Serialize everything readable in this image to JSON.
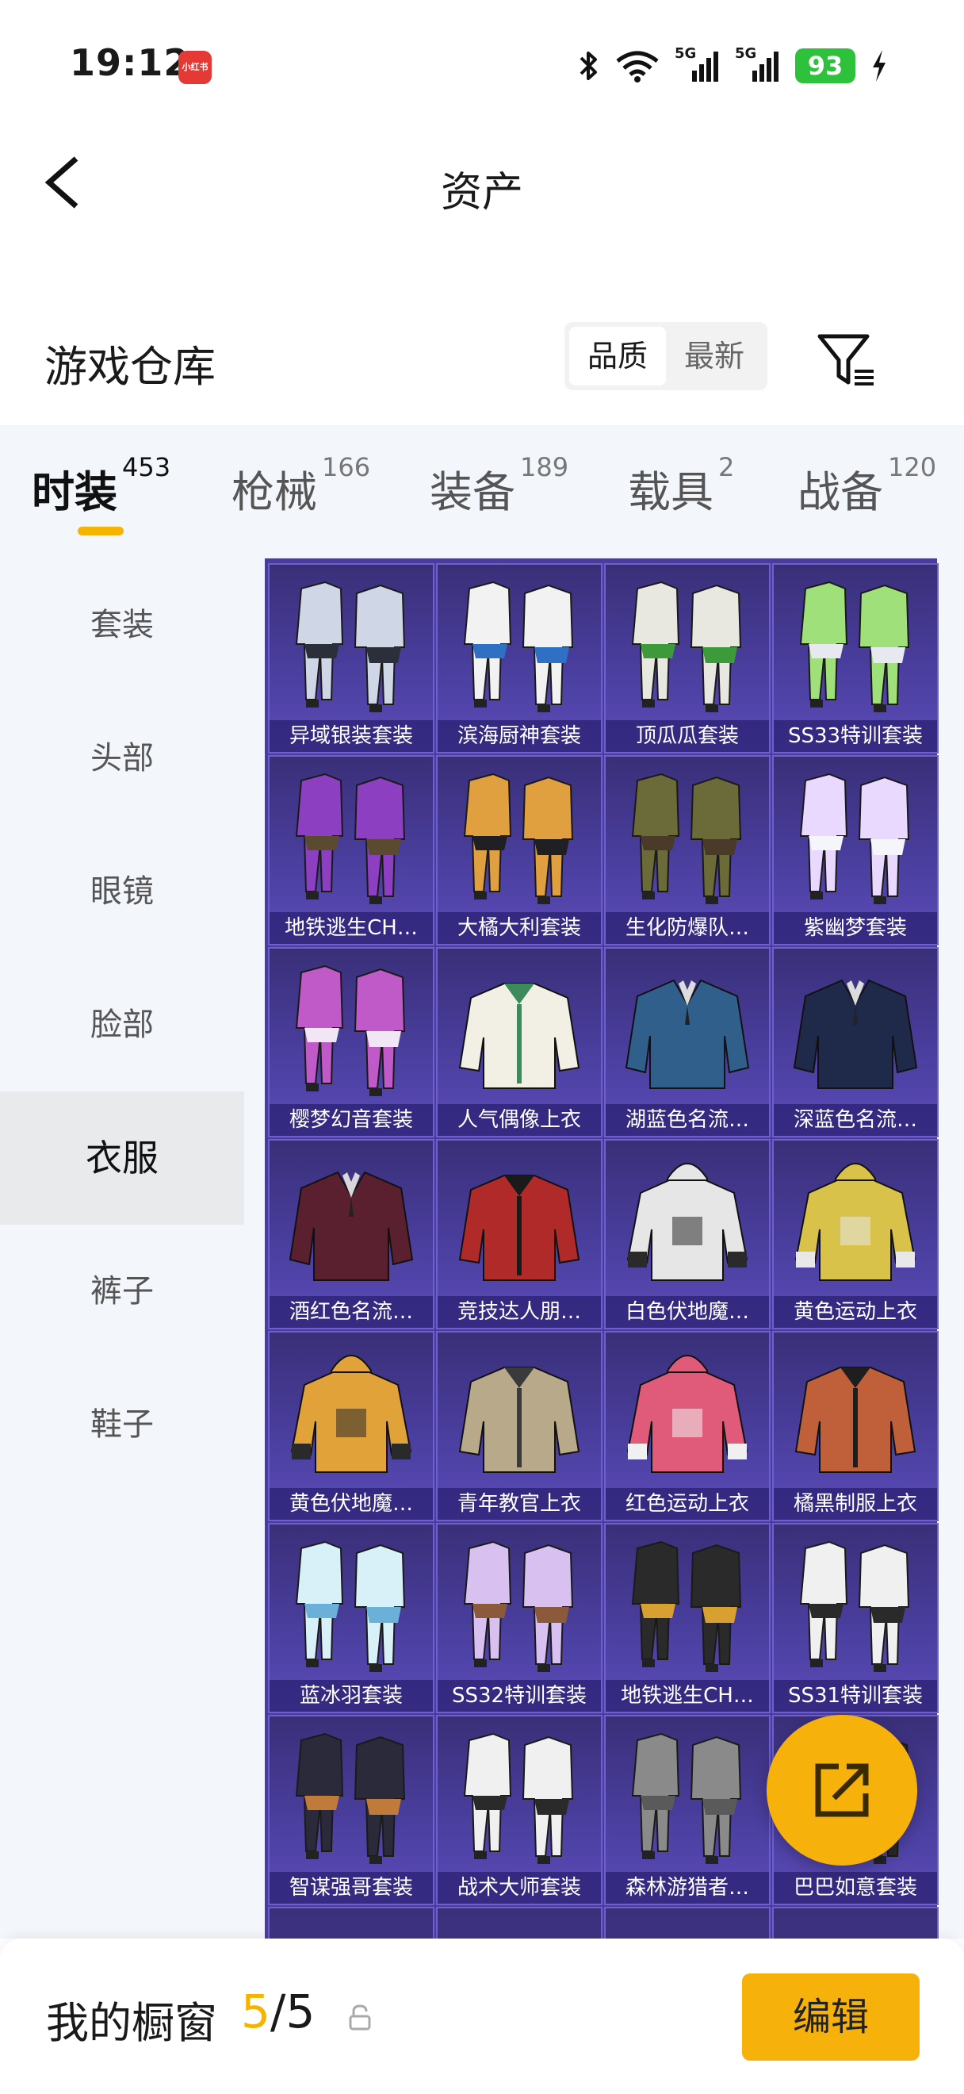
{
  "status_bar": {
    "time": "19:12",
    "app_badge": "小红书",
    "net1": "5G",
    "net2": "5G",
    "battery": "93"
  },
  "header": {
    "title": "资产"
  },
  "warehouse": {
    "title": "游戏仓库",
    "sort_options": [
      "品质",
      "最新"
    ],
    "active_sort": "品质"
  },
  "tabs": [
    {
      "label": "时装",
      "count": "453",
      "active": true
    },
    {
      "label": "枪械",
      "count": "166",
      "active": false
    },
    {
      "label": "装备",
      "count": "189",
      "active": false
    },
    {
      "label": "载具",
      "count": "2",
      "active": false
    },
    {
      "label": "战备",
      "count": "120",
      "active": false
    }
  ],
  "sidebar": [
    {
      "label": "套装",
      "active": false
    },
    {
      "label": "头部",
      "active": false
    },
    {
      "label": "眼镜",
      "active": false
    },
    {
      "label": "脸部",
      "active": false
    },
    {
      "label": "衣服",
      "active": true
    },
    {
      "label": "裤子",
      "active": false
    },
    {
      "label": "鞋子",
      "active": false
    }
  ],
  "items": [
    {
      "name": "异域银装套装",
      "kind": "suit",
      "colors": [
        "#cfd6e6",
        "#2a2f3a"
      ]
    },
    {
      "name": "滨海厨神套装",
      "kind": "suit",
      "colors": [
        "#f2f2f2",
        "#2f6fc4"
      ]
    },
    {
      "name": "顶瓜瓜套装",
      "kind": "suit",
      "colors": [
        "#e8e8e0",
        "#3c9a3a"
      ]
    },
    {
      "name": "SS33特训套装",
      "kind": "suit",
      "colors": [
        "#9fe07a",
        "#e8e8f0"
      ]
    },
    {
      "name": "地铁逃生CH…",
      "kind": "suit",
      "colors": [
        "#8c3fc0",
        "#5a4a30"
      ]
    },
    {
      "name": "大橘大利套装",
      "kind": "suit",
      "colors": [
        "#e0a040",
        "#1f1f24"
      ]
    },
    {
      "name": "生化防爆队…",
      "kind": "suit",
      "colors": [
        "#6b6b3a",
        "#4a3a2a"
      ]
    },
    {
      "name": "紫幽梦套装",
      "kind": "suit",
      "colors": [
        "#e9d8ff",
        "#f5f5fa"
      ]
    },
    {
      "name": "樱梦幻音套装",
      "kind": "suit",
      "colors": [
        "#c05ac8",
        "#f0e6f4"
      ]
    },
    {
      "name": "人气偶像上衣",
      "kind": "top",
      "colors": [
        "#f2efe4",
        "#3d8a5a"
      ]
    },
    {
      "name": "湖蓝色名流…",
      "kind": "blazer",
      "colors": [
        "#2f5f8a",
        "#dcdcdc"
      ]
    },
    {
      "name": "深蓝色名流…",
      "kind": "blazer",
      "colors": [
        "#1f2a4a",
        "#dcdcdc"
      ]
    },
    {
      "name": "酒红色名流…",
      "kind": "blazer",
      "colors": [
        "#5a2030",
        "#d8d8d8"
      ]
    },
    {
      "name": "竞技达人朋…",
      "kind": "top",
      "colors": [
        "#b02a2a",
        "#1a1a1a"
      ]
    },
    {
      "name": "白色伏地魔…",
      "kind": "hoodie",
      "colors": [
        "#e6e6e6",
        "#2a2a2a"
      ]
    },
    {
      "name": "黄色运动上衣",
      "kind": "hoodie",
      "colors": [
        "#d8c24a",
        "#e8e8e8"
      ]
    },
    {
      "name": "黄色伏地魔…",
      "kind": "hoodie",
      "colors": [
        "#e2a23a",
        "#2a2a2a"
      ]
    },
    {
      "name": "青年教官上衣",
      "kind": "top",
      "colors": [
        "#b8a98a",
        "#3a3a3a"
      ]
    },
    {
      "name": "红色运动上衣",
      "kind": "hoodie",
      "colors": [
        "#e05a7a",
        "#f0f0f0"
      ]
    },
    {
      "name": "橘黑制服上衣",
      "kind": "top",
      "colors": [
        "#c0603a",
        "#1e1e1e"
      ]
    },
    {
      "name": "蓝冰羽套装",
      "kind": "suit",
      "colors": [
        "#d8f0f8",
        "#6ab0d8"
      ]
    },
    {
      "name": "SS32特训套装",
      "kind": "suit",
      "colors": [
        "#d8c0f0",
        "#8a5a3a"
      ]
    },
    {
      "name": "地铁逃生CH…",
      "kind": "suit",
      "colors": [
        "#2a2a2a",
        "#d8a030"
      ]
    },
    {
      "name": "SS31特训套装",
      "kind": "suit",
      "colors": [
        "#f0f0f0",
        "#2a2a2a"
      ]
    },
    {
      "name": "智谋强哥套装",
      "kind": "suit",
      "colors": [
        "#2a2a3a",
        "#c07a3a"
      ]
    },
    {
      "name": "战术大师套装",
      "kind": "suit",
      "colors": [
        "#f0f0f0",
        "#2a2a2a"
      ]
    },
    {
      "name": "森林游猎者…",
      "kind": "suit",
      "colors": [
        "#8a8a8a",
        "#5a5a5a"
      ]
    },
    {
      "name": "巴巴如意套装",
      "kind": "suit",
      "colors": [
        "#2a2a2a",
        "#c8c8c8"
      ]
    }
  ],
  "fab": {
    "icon": "share-icon"
  },
  "bottom": {
    "showcase_label": "我的橱窗",
    "showcase_current": "5",
    "showcase_total": "/5",
    "edit_label": "编辑"
  },
  "colors": {
    "accent": "#f7b10b",
    "grid_bg": "#4a3d9a"
  }
}
